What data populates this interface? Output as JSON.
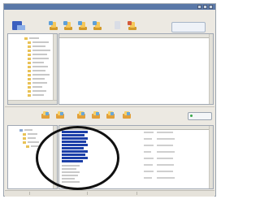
{
  "window": {
    "title": ""
  },
  "menubar": {
    "items": [
      "",
      "",
      "",
      ""
    ]
  },
  "toolbar": {
    "logo_label": "",
    "tools": [
      "folder-connect-icon",
      "folder-open-icon",
      "folder-upload-icon",
      "folder-download-icon",
      "document-icon",
      "folder-sync-icon"
    ],
    "right_logo_label": ""
  },
  "top_file_list": {
    "columns": [
      "",
      "",
      ""
    ]
  },
  "transfer_band": {
    "tools": [
      "folder-connect-icon",
      "folder-open-icon",
      "folder-upload-icon",
      "folder-download-icon",
      "folder-sync-icon",
      "folder-copy-icon"
    ],
    "go_button_label": ""
  },
  "bottom_file_list": {
    "columns": [
      "",
      "",
      ""
    ],
    "selected_rows": 10
  },
  "status_bar": {
    "left": "",
    "middle": "",
    "right": ""
  },
  "annotation": {
    "shape": "ellipse",
    "color": "#111111"
  },
  "colors": {
    "title_bar": "#5a78a8",
    "selection": "#1c3fa8",
    "folder": "#e9c256",
    "accent_orange": "#e2a03a"
  }
}
